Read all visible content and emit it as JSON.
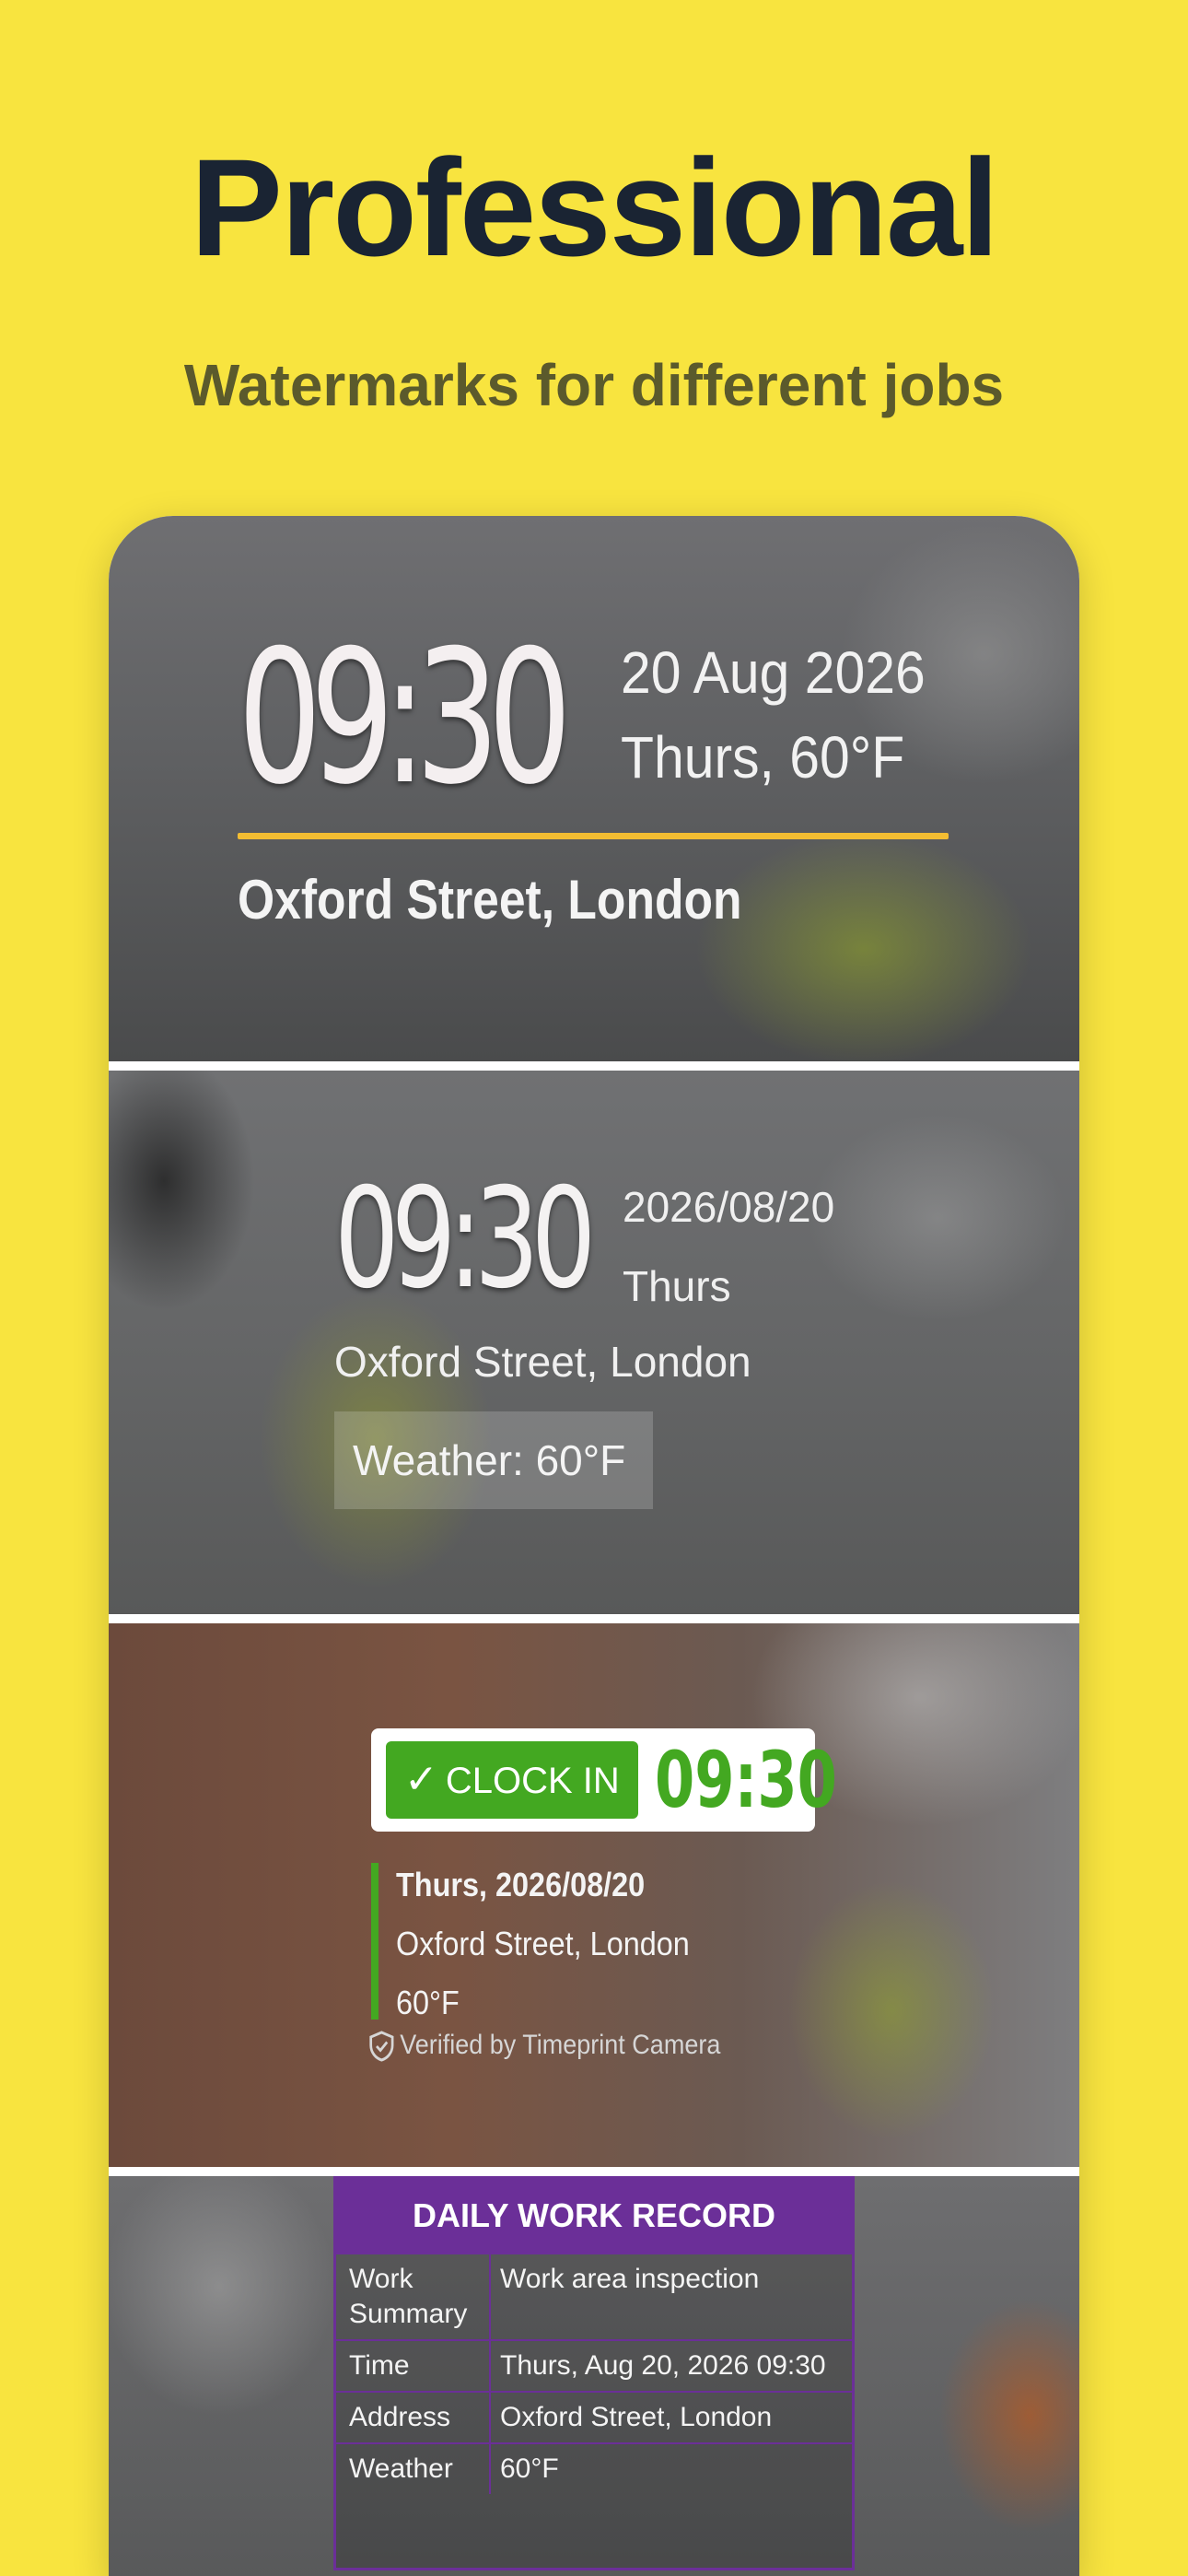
{
  "header": {
    "title": "Professional",
    "subtitle": "Watermarks for different jobs"
  },
  "watermarks": {
    "w1": {
      "time": "09:30",
      "date": "20 Aug 2026",
      "day_weather": "Thurs, 60°F",
      "address": "Oxford Street, London",
      "accent_color": "#f3bd32"
    },
    "w2": {
      "time": "09:30",
      "date": "2026/08/20",
      "day": "Thurs",
      "address": "Oxford Street, London",
      "weather": "Weather: 60°F"
    },
    "w3": {
      "clock_in_label": "CLOCK IN",
      "time": "09:30",
      "date": "Thurs, 2026/08/20",
      "address": "Oxford Street, London",
      "weather": "60°F",
      "verified": "Verified by Timeprint Camera",
      "accent_color": "#43a821",
      "icons": [
        "checkmark-icon",
        "shield-check-icon"
      ]
    },
    "w4": {
      "title": "DAILY WORK RECORD",
      "accent_color": "#6b2f98",
      "rows": [
        {
          "key": "Work Summary",
          "value": "Work area inspection"
        },
        {
          "key": "Time",
          "value": "Thurs, Aug 20, 2026 09:30"
        },
        {
          "key": "Address",
          "value": "Oxford Street, London"
        },
        {
          "key": "Weather",
          "value": "60°F"
        }
      ]
    }
  }
}
